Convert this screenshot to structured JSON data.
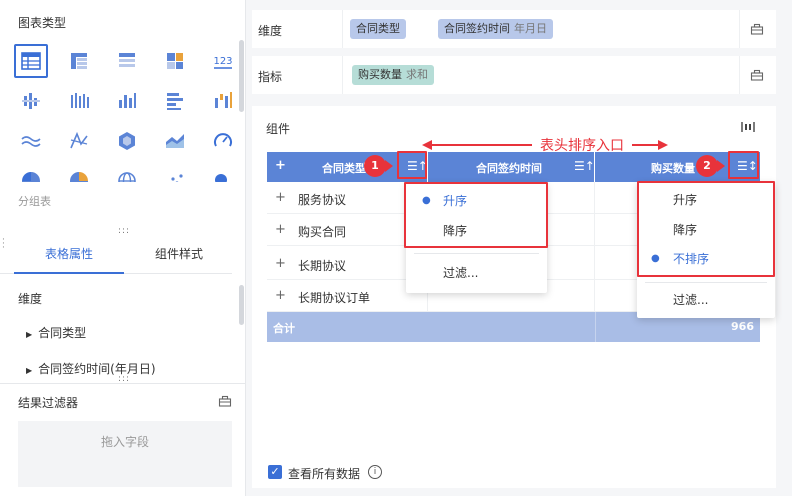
{
  "left_panel": {
    "chart_type_title": "图表类型",
    "first_row_numeric_icon": "123",
    "chart_icons": [
      "table-icon",
      "cross-table-icon",
      "group-table-icon",
      "block-table-icon",
      "number-icon",
      "scatter-bar-icon",
      "multi-bar-icon",
      "column-chart-icon",
      "bar-chart-icon",
      "waterfall-icon",
      "line-chart-icon",
      "radar-icon",
      "hexagon-icon",
      "area-chart-icon",
      "gauge-icon",
      "pie-icon",
      "donut-icon",
      "globe-icon",
      "dot-chart-icon",
      "bubble-icon"
    ],
    "hover_label": "分组表",
    "tabs": [
      "表格属性",
      "组件样式"
    ],
    "active_tab": 0,
    "dimension_title": "维度",
    "dimension_items": [
      "合同类型",
      "合同签约时间(年月日)"
    ],
    "filter_title": "结果过滤器",
    "drop_placeholder": "拖入字段"
  },
  "dimension_row": {
    "label": "维度",
    "chips": [
      {
        "text": "合同类型",
        "sub": ""
      },
      {
        "text": "合同签约时间",
        "sub": "年月日"
      }
    ]
  },
  "indicator_row": {
    "label": "指标",
    "chips": [
      {
        "text": "购买数量",
        "sub": "求和"
      }
    ]
  },
  "component": {
    "title": "组件",
    "annotation": "表头排序入口",
    "table": {
      "headers": [
        "合同类型",
        "合同签约时间",
        "购买数量"
      ],
      "expand_symbol": "+",
      "rows": [
        "服务协议",
        "购买合同",
        "长期协议",
        "长期协议订单"
      ],
      "total_label": "合计",
      "total_value": "966"
    },
    "badge1": "1",
    "badge2": "2",
    "menu1": {
      "items": [
        "升序",
        "降序"
      ],
      "selected": "升序",
      "filter": "过滤..."
    },
    "menu2": {
      "items": [
        "升序",
        "降序",
        "不排序"
      ],
      "selected": "不排序",
      "filter": "过滤..."
    },
    "show_all_label": "查看所有数据",
    "show_all_checked": true
  },
  "colors": {
    "accent": "#3a6fd6",
    "header_bg": "#5b84d6",
    "total_bg": "#a9bde6",
    "annotation_red": "#e8333b",
    "dim_chip": "#b8c8ea",
    "ind_chip": "#b6ddd7"
  }
}
